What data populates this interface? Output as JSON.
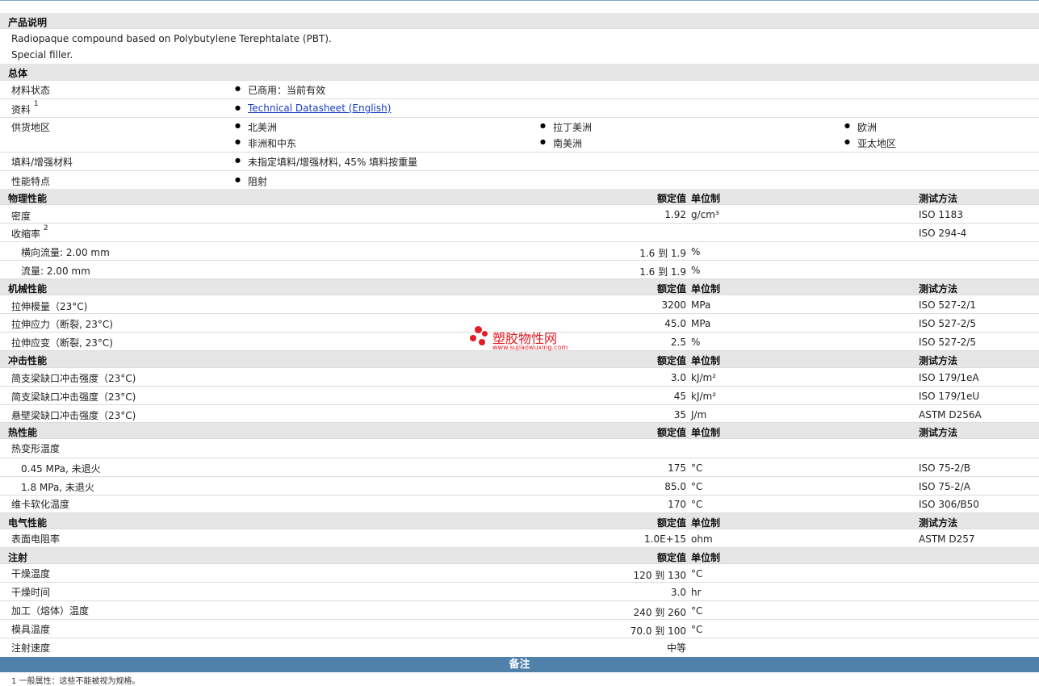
{
  "sections": {
    "desc": {
      "title": "产品说明",
      "lines": [
        "Radiopaque compound based on Polybutylene Terephtalate (PBT).",
        "Special filler."
      ]
    },
    "general": {
      "title": "总体",
      "status_label": "材料状态",
      "status_value": "已商用：当前有效",
      "docs_label": "资料",
      "docs_sup": "1",
      "docs_link": "Technical Datasheet (English)",
      "supply_label": "供货地区",
      "regions": [
        "北美洲",
        "拉丁美洲",
        "欧洲",
        "非洲和中东",
        "南美洲",
        "亚太地区"
      ],
      "filler_label": "填料/增强材料",
      "filler_value": "未指定填料/增强材料, 45% 填料按重量",
      "features_label": "性能特点",
      "features_value": "阻射"
    },
    "physical": {
      "title": "物理性能",
      "h_val": "额定值",
      "h_unit": "单位制",
      "h_test": "测试方法",
      "rows": [
        {
          "label": "密度",
          "value": "1.92",
          "unit": "g/cm³",
          "test": "ISO 1183"
        },
        {
          "label": "收缩率",
          "sup": "2",
          "value": "",
          "unit": "",
          "test": "ISO 294-4"
        },
        {
          "label": "横向流量: 2.00 mm",
          "value": "1.6 到  1.9",
          "unit": "%",
          "test": ""
        },
        {
          "label": "流量: 2.00 mm",
          "value": "1.6 到  1.9",
          "unit": "%",
          "test": ""
        }
      ]
    },
    "mechanical": {
      "title": "机械性能",
      "h_val": "额定值",
      "h_unit": "单位制",
      "h_test": "测试方法",
      "rows": [
        {
          "label": "拉伸模量（23°C)",
          "value": "3200",
          "unit": "MPa",
          "test": "ISO 527-2/1"
        },
        {
          "label": "拉伸应力（断裂, 23°C)",
          "value": "45.0",
          "unit": "MPa",
          "test": "ISO 527-2/5"
        },
        {
          "label": "拉伸应变（断裂, 23°C)",
          "value": "2.5",
          "unit": "%",
          "test": "ISO 527-2/5"
        }
      ]
    },
    "impact": {
      "title": "冲击性能",
      "h_val": "额定值",
      "h_unit": "单位制",
      "h_test": "测试方法",
      "rows": [
        {
          "label": "简支梁缺口冲击强度（23°C)",
          "value": "3.0",
          "unit": "kJ/m²",
          "test": "ISO 179/1eA"
        },
        {
          "label": "简支梁缺口冲击强度（23°C)",
          "value": "45",
          "unit": "kJ/m²",
          "test": "ISO 179/1eU"
        },
        {
          "label": "悬壁梁缺口冲击强度（23°C)",
          "value": "35",
          "unit": "J/m",
          "test": "ASTM D256A"
        }
      ]
    },
    "thermal": {
      "title": "热性能",
      "h_val": "额定值",
      "h_unit": "单位制",
      "h_test": "测试方法",
      "rows": [
        {
          "label": "热变形温度",
          "value": "",
          "unit": "",
          "test": ""
        },
        {
          "label": "0.45 MPa, 未退火",
          "value": "175",
          "unit": "°C",
          "test": "ISO 75-2/B"
        },
        {
          "label": "1.8 MPa, 未退火",
          "value": "85.0",
          "unit": "°C",
          "test": "ISO 75-2/A"
        },
        {
          "label": "维卡软化温度",
          "value": "170",
          "unit": "°C",
          "test": "ISO 306/B50"
        }
      ]
    },
    "electrical": {
      "title": "电气性能",
      "h_val": "额定值",
      "h_unit": "单位制",
      "h_test": "测试方法",
      "rows": [
        {
          "label": "表面电阻率",
          "value": "1.0E+15",
          "unit": "ohm",
          "test": "ASTM D257"
        }
      ]
    },
    "injection": {
      "title": "注射",
      "h_val": "额定值",
      "h_unit": "单位制",
      "rows": [
        {
          "label": "干燥温度",
          "value": "120 到  130",
          "unit": "°C"
        },
        {
          "label": "干燥时间",
          "value": "3.0",
          "unit": "hr"
        },
        {
          "label": "加工（熔体）温度",
          "value": "240 到  260",
          "unit": "°C"
        },
        {
          "label": "模具温度",
          "value": "70.0 到  100",
          "unit": "°C"
        },
        {
          "label": "注射速度",
          "value": "中等",
          "unit": ""
        }
      ]
    },
    "notes": {
      "title": "备注",
      "footnote": "1 一般属性：这些不能被视为规格。"
    }
  },
  "watermark": {
    "name": "塑胶物性网",
    "url": "www.sujiaowuxing.com",
    "color": "#e31b23"
  },
  "colors": {
    "section_bg": "#e6e6e6",
    "notes_bg": "#4f81ab",
    "link": "#1a3cc8"
  }
}
